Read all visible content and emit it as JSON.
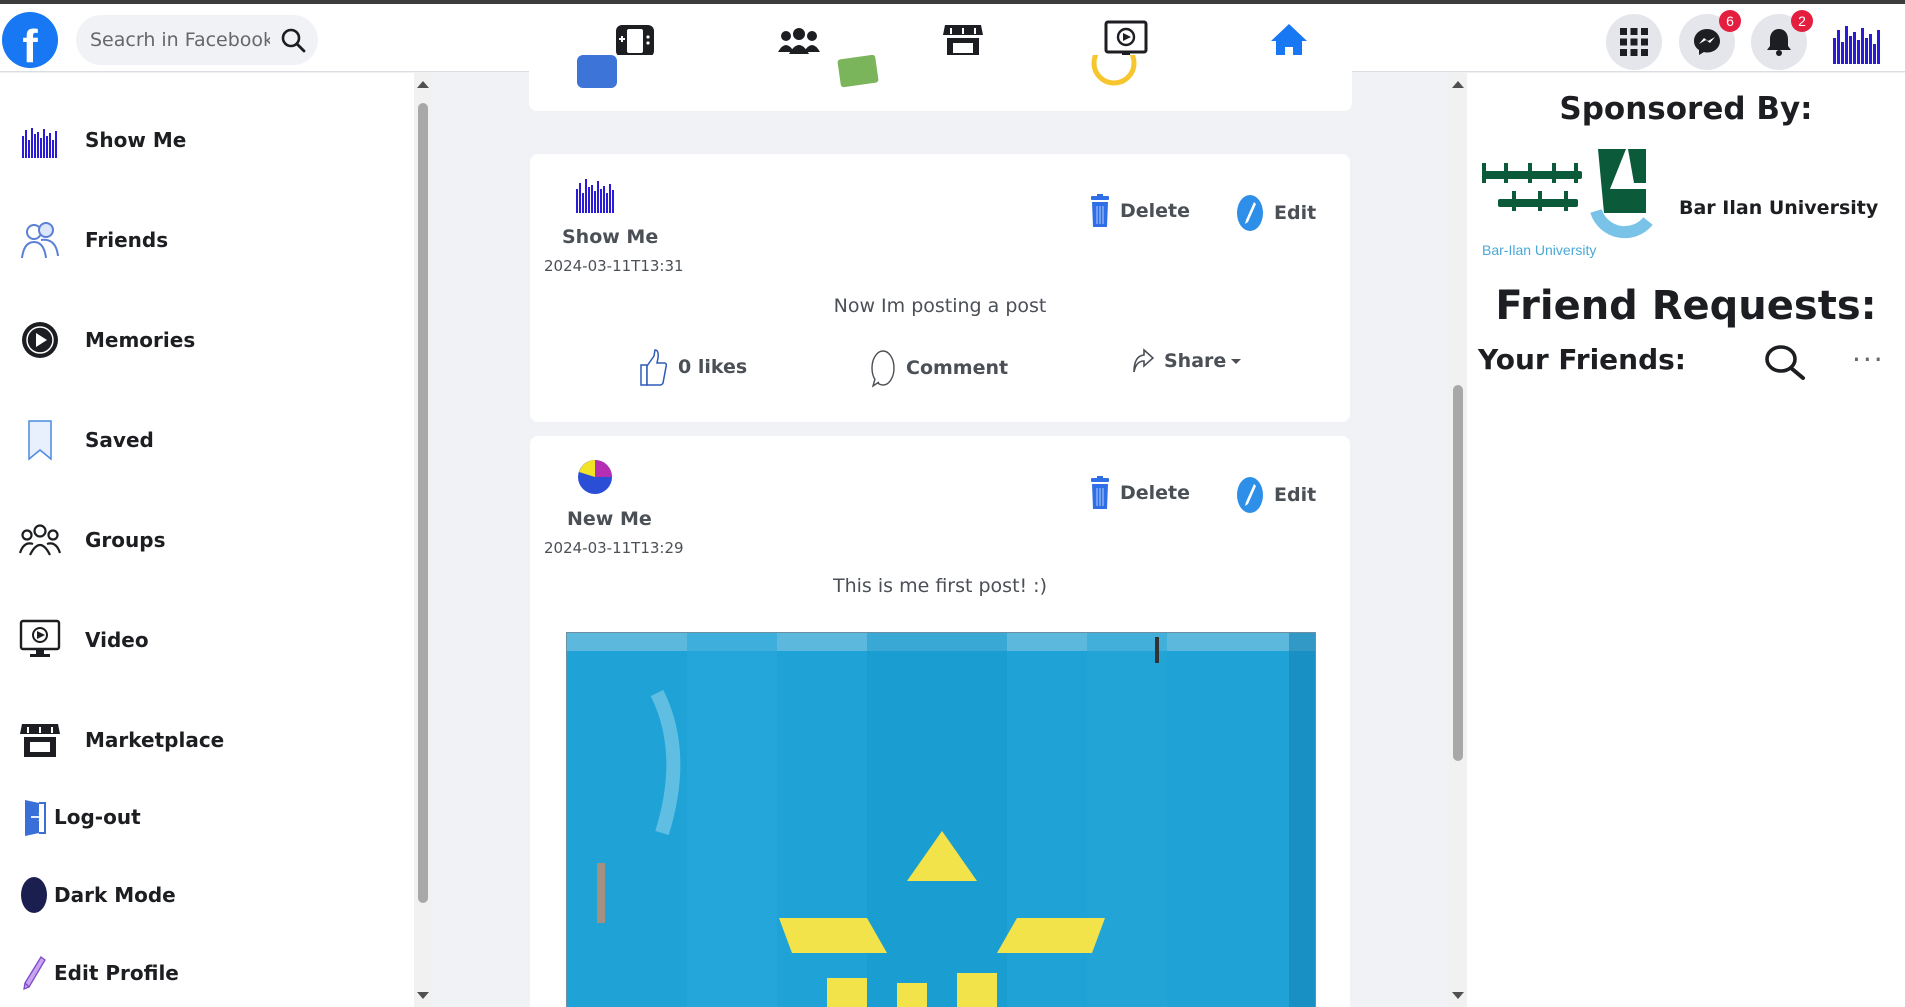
{
  "header": {
    "logo_letter": "f",
    "search_placeholder": "Seacrh in Facebook",
    "messenger_badge": "6",
    "notifications_badge": "2",
    "nav_icons": [
      "gaming-icon",
      "groups-icon",
      "marketplace-icon",
      "video-icon",
      "home-icon"
    ],
    "active_nav": "home-icon",
    "accent_color": "#1877f2"
  },
  "sidebar": {
    "items": [
      {
        "label": "Show Me",
        "icon": "profile-avatar"
      },
      {
        "label": "Friends",
        "icon": "friends-icon"
      },
      {
        "label": "Memories",
        "icon": "memories-icon"
      },
      {
        "label": "Saved",
        "icon": "bookmark-icon"
      },
      {
        "label": "Groups",
        "icon": "groups-icon"
      },
      {
        "label": "Video",
        "icon": "video-icon"
      },
      {
        "label": "Marketplace",
        "icon": "marketplace-icon"
      },
      {
        "label": "Log-out",
        "icon": "logout-icon"
      },
      {
        "label": "Dark Mode",
        "icon": "moon-icon"
      },
      {
        "label": "Edit Profile",
        "icon": "pencil-icon"
      }
    ]
  },
  "posts": [
    {
      "author": "Show Me",
      "date": "2024-03-11T13:31",
      "text": "Now Im posting a post",
      "delete_label": "Delete",
      "edit_label": "Edit",
      "likes_label": "0 likes",
      "comment_label": "Comment",
      "share_label": "Share"
    },
    {
      "author": "New Me",
      "date": "2024-03-11T13:29",
      "text": "This is me first post! :)",
      "delete_label": "Delete",
      "edit_label": "Edit"
    }
  ],
  "right": {
    "sponsored_title": "Sponsored By:",
    "sponsor_name": "Bar Ilan University",
    "sponsor_logo_text": "Bar-Ilan University",
    "friend_requests_title": "Friend Requests:",
    "your_friends_title": "Your Friends:",
    "more_label": "···"
  }
}
